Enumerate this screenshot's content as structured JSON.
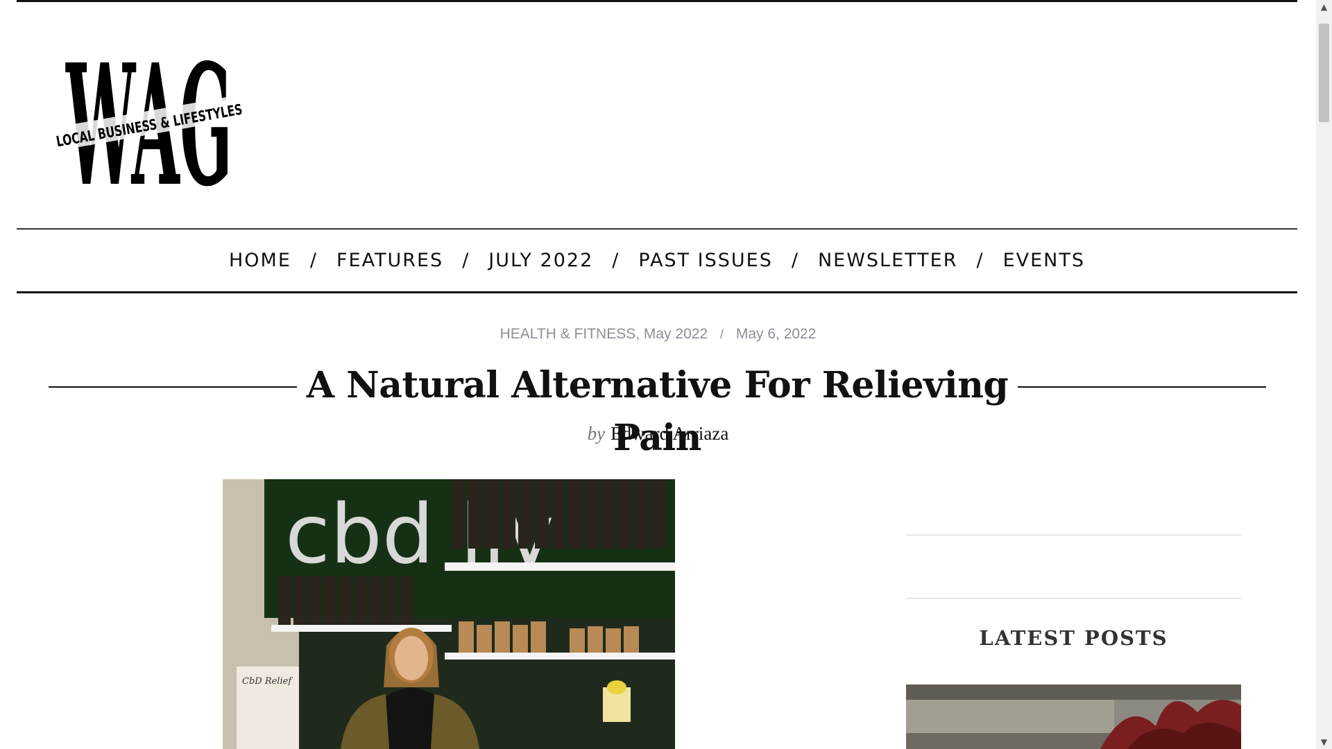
{
  "logo": {
    "letters": "WAG",
    "tagline": "LOCAL BUSINESS & LIFESTYLES"
  },
  "nav": {
    "items": [
      {
        "label": "HOME"
      },
      {
        "label": "FEATURES"
      },
      {
        "label": "JULY 2022"
      },
      {
        "label": "PAST ISSUES"
      },
      {
        "label": "NEWSLETTER"
      },
      {
        "label": "EVENTS"
      }
    ],
    "separator": "/"
  },
  "article": {
    "category": "HEALTH & FITNESS",
    "issue": "May 2022",
    "date_separator": "/",
    "date": "May 6, 2022",
    "title": "A Natural Alternative For Relieving Pain",
    "by_label": "by",
    "author": "Edward Arriaza",
    "image_sign_text": "cbd liv",
    "image_card_text": "CbD Relief"
  },
  "sidebar": {
    "latest_heading": "LATEST POSTS"
  },
  "scrollbar": {
    "up_icon": "▲",
    "down_icon": "▼"
  },
  "colors": {
    "text": "#111111",
    "meta_gray": "#8a8f98",
    "rule": "#111111"
  }
}
